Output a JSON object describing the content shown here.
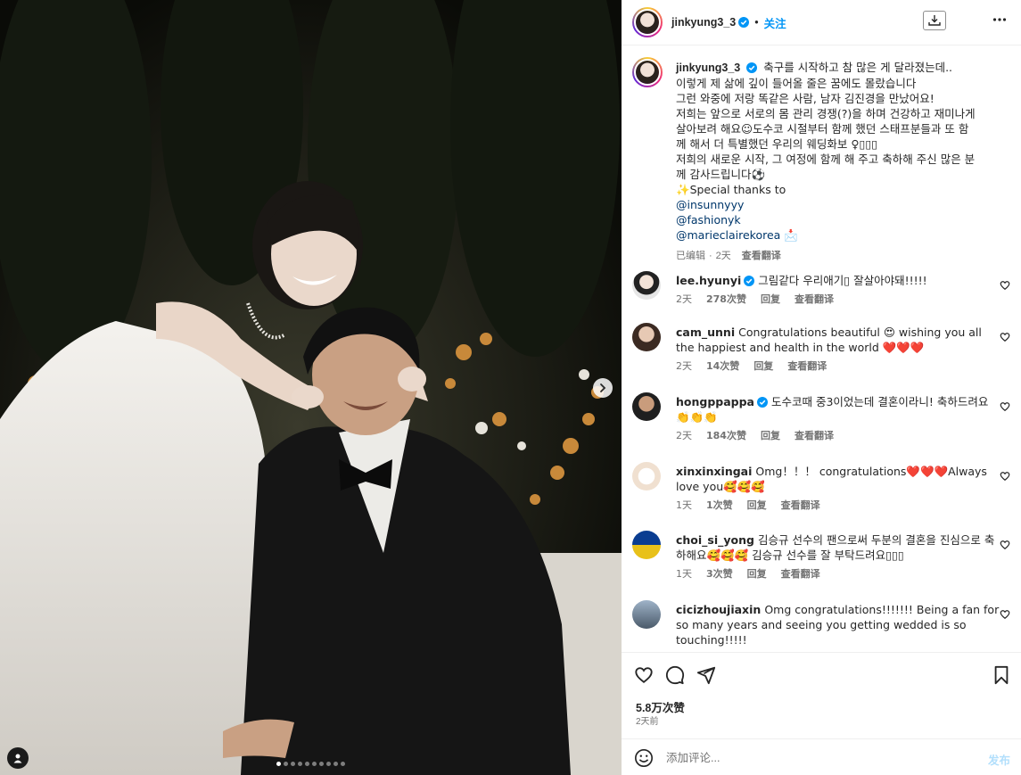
{
  "post": {
    "username": "jinkyung3_3",
    "follow_label": "关注",
    "separator": "•",
    "caption_lines": [
      "축구를 시작하고 참 많은 게 달라졌는데..",
      "이렇게 제 삶에 깊이 들어올 줄은 꿈에도 몰랐습니다",
      "그런 와중에 저랑 똑같은 사람, 남자 김진경을 만났어요!",
      "저희는 앞으로 서로의 몸 관리 경쟁(?)을 하며 건강하고 재미나게",
      "살아보려 해요☺도수코 시절부터 함께 했던 스태프분들과 또 함",
      "께 해서 더 특별했던 우리의 웨딩화보 ♀▯▯▯",
      "저희의 새로운 시작, 그 여정에 함께 해 주고 축하해 주신 많은 분",
      "께 감사드립니다⚽",
      "✨Special thanks to"
    ],
    "mentions": [
      "@insunnyyy",
      "@fashionyk",
      "@marieclairekorea 📩"
    ],
    "caption_meta": {
      "edited": "已编辑",
      "dot": "·",
      "age": "2天",
      "translate": "查看翻译"
    }
  },
  "comments": [
    {
      "user": "lee.hyunyi",
      "verified": true,
      "text": "그림같다 우리애기▯ 잘살아야돼!!!!!",
      "age": "2天",
      "likes": "278次赞",
      "reply": "回复",
      "translate": "查看翻译"
    },
    {
      "user": "cam_unni",
      "verified": false,
      "text": "Congratulations beautiful 😍 wishing you all the happiest and health in the world ❤️❤️❤️",
      "age": "2天",
      "likes": "14次赞",
      "reply": "回复",
      "translate": "查看翻译"
    },
    {
      "user": "hongppappa",
      "verified": true,
      "text": "도수코때 중3이었는데 결혼이라니! 축하드려요👏👏👏",
      "age": "2天",
      "likes": "184次赞",
      "reply": "回复",
      "translate": "查看翻译"
    },
    {
      "user": "xinxinxingai",
      "verified": false,
      "text": "Omg！！！ congratulations❤️❤️❤️Always love you🥰🥰🥰",
      "age": "1天",
      "likes": "1次赞",
      "reply": "回复",
      "translate": "查看翻译"
    },
    {
      "user": "choi_si_yong",
      "verified": false,
      "text": "김승규 선수의 팬으로써 두분의 결혼을 진심으로 축하해요🥰🥰🥰 김승규 선수를 잘 부탁드려요▯▯▯",
      "age": "1天",
      "likes": "3次赞",
      "reply": "回复",
      "translate": "查看翻译"
    },
    {
      "user": "cicizhoujiaxin",
      "verified": false,
      "text": "Omg congratulations!!!!!!! Being a fan for so many years and seeing you getting wedded is so touching!!!!!",
      "age": "",
      "likes": "",
      "reply": "",
      "translate": ""
    }
  ],
  "footer": {
    "likes": "5.8万次赞",
    "date": "2天前",
    "comment_placeholder": "添加评论...",
    "post_label": "发布"
  },
  "carousel": {
    "total": 10,
    "active_index": 0
  },
  "icons": [
    "verified-badge-icon",
    "download-icon",
    "more-options-icon",
    "heart-icon",
    "comment-icon",
    "share-icon",
    "bookmark-icon",
    "smiley-icon",
    "chevron-right-icon",
    "user-tag-icon"
  ],
  "colors": {
    "accent": "#0095f6",
    "text": "#262626",
    "muted": "#737373",
    "mention": "#00376b",
    "like_red": "#ed4956"
  }
}
